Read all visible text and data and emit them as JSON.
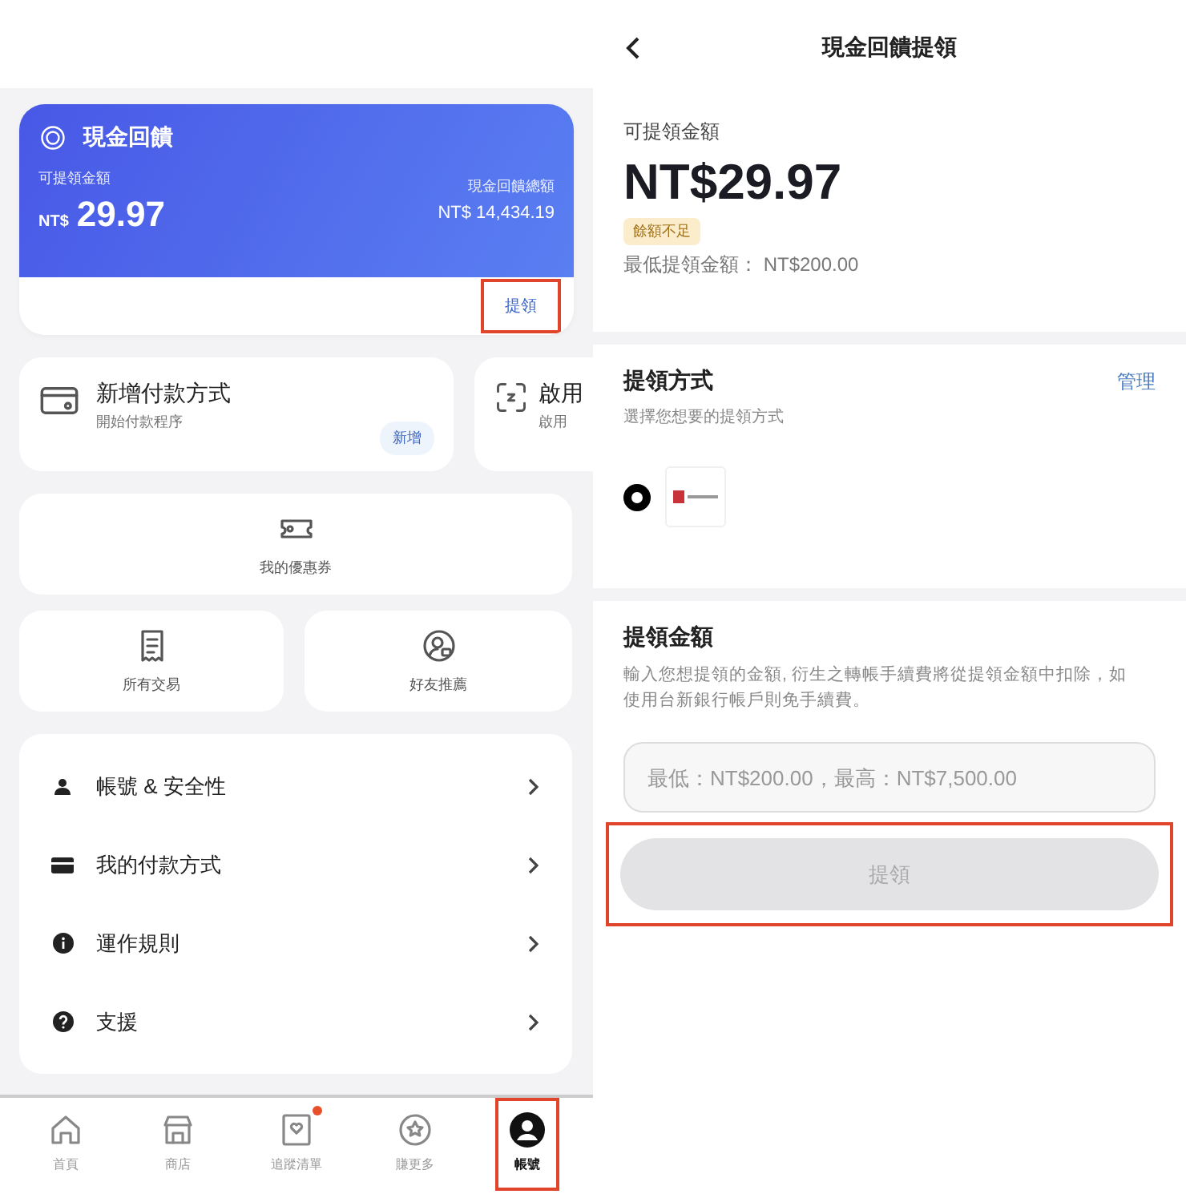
{
  "left": {
    "cashback_card": {
      "title": "現金回饋",
      "available_label": "可提領金額",
      "currency": "NT$",
      "available_amount": "29.97",
      "total_label": "現金回饋總額",
      "total_amount": "NT$ 14,434.19",
      "withdraw_button": {
        "label": "提領",
        "highlighted": true
      }
    },
    "action_cards": [
      {
        "kind": "card",
        "title": "新增付款方式",
        "subtitle": "開始付款程序",
        "button": "新增"
      },
      {
        "kind": "scan",
        "title": "啟用",
        "subtitle": "啟用"
      }
    ],
    "shortcuts": [
      {
        "kind": "coupon",
        "label": "我的優惠券"
      },
      {
        "kind": "receipt",
        "label": "所有交易"
      },
      {
        "kind": "referral",
        "label": "好友推薦"
      }
    ],
    "menu": [
      {
        "kind": "person",
        "label": "帳號 & 安全性"
      },
      {
        "kind": "card",
        "label": "我的付款方式"
      },
      {
        "kind": "info",
        "label": "運作規則"
      },
      {
        "kind": "help",
        "label": "支援"
      }
    ],
    "tab_bar": [
      {
        "kind": "home",
        "label": "首頁",
        "selected": false,
        "badge": false,
        "highlighted": false
      },
      {
        "kind": "store",
        "label": "商店",
        "selected": false,
        "badge": false,
        "highlighted": false
      },
      {
        "kind": "watchlist",
        "label": "追蹤清單",
        "selected": false,
        "badge": true,
        "highlighted": false
      },
      {
        "kind": "earn",
        "label": "賺更多",
        "selected": false,
        "badge": false,
        "highlighted": false
      },
      {
        "kind": "account",
        "label": "帳號",
        "selected": true,
        "badge": false,
        "highlighted": true
      }
    ]
  },
  "right": {
    "header": {
      "title": "現金回饋提領"
    },
    "balance": {
      "label": "可提領金額",
      "amount": "NT$29.97",
      "status_tag": "餘額不足",
      "minimum": "最低提領金額： NT$200.00"
    },
    "method": {
      "title": "提領方式",
      "manage_link": "管理",
      "subtitle": "選擇您想要的提領方式",
      "options": [
        {
          "selected": true
        }
      ]
    },
    "amount": {
      "title": "提領金額",
      "description": "輸入您想提領的金額, 衍生之轉帳手續費將從提領金額中扣除，如使用台新銀行帳戶則免手續費。",
      "placeholder": "最低：NT$200.00，最高：NT$7,500.00",
      "submit_button": {
        "label": "提領",
        "disabled": true,
        "highlighted": true
      }
    }
  }
}
